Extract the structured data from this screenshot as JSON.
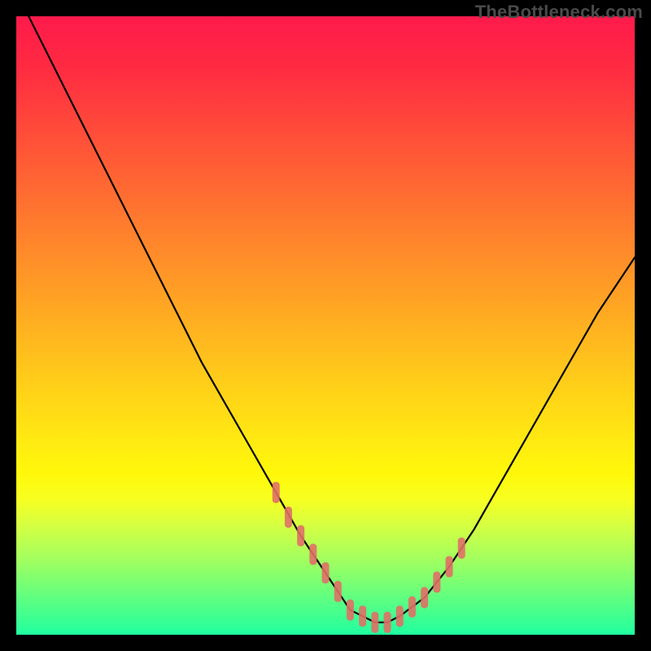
{
  "watermark": "TheBottleneck.com",
  "chart_data": {
    "type": "line",
    "title": "",
    "xlabel": "",
    "ylabel": "",
    "xlim": [
      0,
      100
    ],
    "ylim": [
      0,
      100
    ],
    "series": [
      {
        "name": "bottleneck-curve",
        "x": [
          2,
          6,
          10,
          14,
          18,
          22,
          26,
          30,
          34,
          38,
          42,
          46,
          50,
          52,
          54,
          56,
          58,
          60,
          62,
          66,
          70,
          74,
          78,
          82,
          86,
          90,
          94,
          98,
          100
        ],
        "values": [
          100,
          92,
          84,
          76,
          68,
          60,
          52,
          44,
          37,
          30,
          23,
          16,
          10,
          7,
          4,
          3,
          2,
          2,
          3,
          6,
          11,
          17,
          24,
          31,
          38,
          45,
          52,
          58,
          61
        ]
      }
    ],
    "markers": [
      {
        "name": "highlight-band",
        "x": [
          42,
          44,
          46,
          48,
          50,
          52,
          54,
          56,
          58,
          60,
          62,
          64,
          66,
          68,
          70,
          72
        ],
        "values": [
          23,
          19,
          16,
          13,
          10,
          7,
          4,
          3,
          2,
          2,
          3,
          4.5,
          6,
          8.5,
          11,
          14
        ]
      }
    ]
  }
}
